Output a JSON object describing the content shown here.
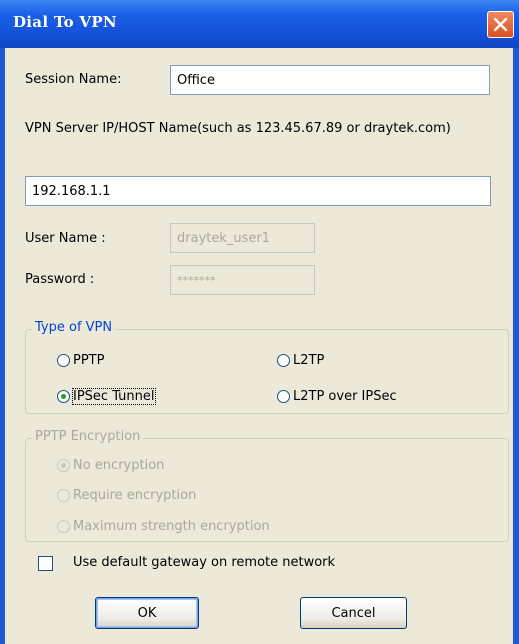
{
  "window": {
    "title": "Dial To VPN"
  },
  "form": {
    "session_name_label": "Session Name:",
    "session_name_value": "Office",
    "server_label": "VPN Server IP/HOST Name(such as 123.45.67.89 or draytek.com)",
    "server_value": "192.168.1.1",
    "username_label": "User Name :",
    "username_value": "draytek_user1",
    "password_label": "Password :",
    "password_value": "*******"
  },
  "vpn_type": {
    "title": "Type of VPN",
    "options": [
      {
        "label": "PPTP",
        "selected": false
      },
      {
        "label": "L2TP",
        "selected": false
      },
      {
        "label": "IPSec Tunnel",
        "selected": true
      },
      {
        "label": "L2TP over IPSec",
        "selected": false
      }
    ]
  },
  "pptp_encryption": {
    "title": "PPTP Encryption",
    "enabled": false,
    "options": [
      {
        "label": "No encryption",
        "selected": true
      },
      {
        "label": "Require encryption",
        "selected": false
      },
      {
        "label": "Maximum strength encryption",
        "selected": false
      }
    ]
  },
  "default_gateway": {
    "label": "Use default gateway on remote network",
    "checked": false
  },
  "buttons": {
    "ok": "OK",
    "cancel": "Cancel"
  },
  "colors": {
    "title_bar": "#1a5fe6",
    "dialog_bg": "#ece9d8",
    "group_title": "#0046d5",
    "close_button": "#e0602f"
  }
}
